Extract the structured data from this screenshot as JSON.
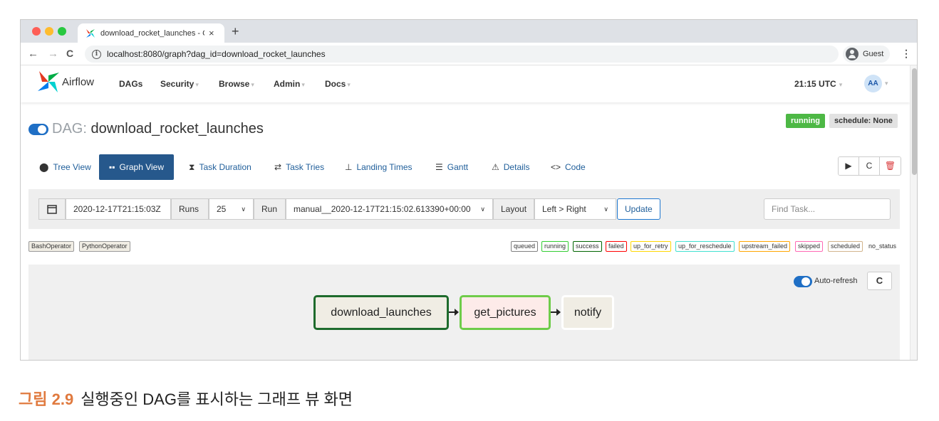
{
  "browser": {
    "tab_title": "download_rocket_launches - C",
    "tab_close": "×",
    "new_tab": "+",
    "url": "localhost:8080/graph?dag_id=download_rocket_launches",
    "profile_label": "Guest"
  },
  "navbar": {
    "brand": "Airflow",
    "menu": [
      {
        "label": "DAGs",
        "caret": ""
      },
      {
        "label": "Security",
        "caret": "▾"
      },
      {
        "label": "Browse",
        "caret": "▾"
      },
      {
        "label": "Admin",
        "caret": "▾"
      },
      {
        "label": "Docs",
        "caret": "▾"
      }
    ],
    "clock": "21:15 UTC",
    "user_initials": "AA"
  },
  "dag": {
    "prefix": "DAG:",
    "name": "download_rocket_launches",
    "state_badge": "running",
    "schedule_badge": "schedule: None"
  },
  "views": [
    {
      "label": "Tree View",
      "icon": "tree-icon"
    },
    {
      "label": "Graph View",
      "icon": "graph-icon"
    },
    {
      "label": "Task Duration",
      "icon": "hourglass-icon"
    },
    {
      "label": "Task Tries",
      "icon": "repeat-icon"
    },
    {
      "label": "Landing Times",
      "icon": "landing-icon"
    },
    {
      "label": "Gantt",
      "icon": "gantt-icon"
    },
    {
      "label": "Details",
      "icon": "warning-icon"
    },
    {
      "label": "Code",
      "icon": "code-icon"
    }
  ],
  "form": {
    "execution_date": "2020-12-17T21:15:03Z",
    "runs_label": "Runs",
    "runs_value": "25",
    "run_label": "Run",
    "run_value": "manual__2020-12-17T21:15:02.613390+00:00",
    "layout_label": "Layout",
    "layout_value": "Left > Right",
    "update_label": "Update",
    "find_placeholder": "Find Task..."
  },
  "operators": [
    "BashOperator",
    "PythonOperator"
  ],
  "statuses": [
    {
      "label": "queued",
      "color": "#808080"
    },
    {
      "label": "running",
      "color": "#32cd32"
    },
    {
      "label": "success",
      "color": "#006400"
    },
    {
      "label": "failed",
      "color": "#ff0000"
    },
    {
      "label": "up_for_retry",
      "color": "#ffd700"
    },
    {
      "label": "up_for_reschedule",
      "color": "#40e0d0"
    },
    {
      "label": "upstream_failed",
      "color": "#ffa500"
    },
    {
      "label": "skipped",
      "color": "#ff69b4"
    },
    {
      "label": "scheduled",
      "color": "#d2b48c"
    }
  ],
  "no_status_label": "no_status",
  "graph": {
    "autorefresh_label": "Auto-refresh",
    "nodes": [
      {
        "id": "download_launches",
        "status": "success"
      },
      {
        "id": "get_pictures",
        "status": "running"
      },
      {
        "id": "notify",
        "status": "no_status"
      }
    ]
  },
  "caption": {
    "label": "그림 2.9",
    "text": "실행중인 DAG를 표시하는 그래프 뷰 화면"
  }
}
